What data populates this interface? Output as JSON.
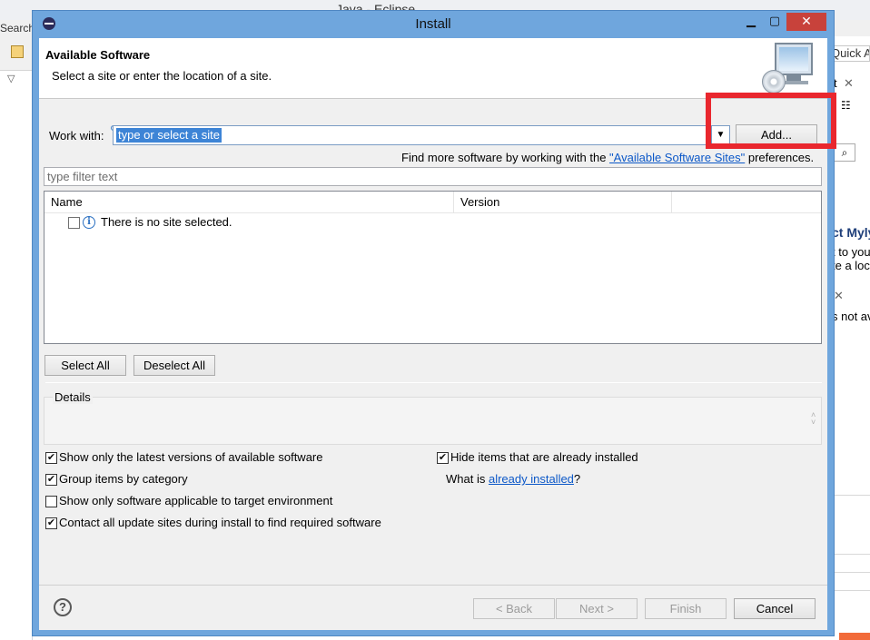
{
  "background": {
    "title": "Java - Eclipse",
    "search": "Search",
    "quick_access": "Quick Access",
    "right_fragments": [
      "t",
      "ct Myly",
      "t to you",
      "te a loc",
      "s not av"
    ]
  },
  "dialog": {
    "title": "Install",
    "header": {
      "title": "Available Software",
      "description": "Select a site or enter the location of a site."
    },
    "work_with": {
      "label": "Work with:",
      "value": "type or select a site",
      "add_button": "Add...",
      "find_more_prefix": "Find more software by working with the ",
      "find_more_link": "\"Available Software Sites\"",
      "find_more_suffix": " preferences."
    },
    "filter": {
      "placeholder": "type filter text"
    },
    "table": {
      "columns": [
        "Name",
        "Version"
      ],
      "rows": [
        {
          "label": "There is no site selected.",
          "checked": false
        }
      ]
    },
    "select_all": "Select All",
    "deselect_all": "Deselect All",
    "details": {
      "label": "Details"
    },
    "options": {
      "latest_versions": {
        "label": "Show only the latest versions of available software",
        "checked": true
      },
      "group_by_category": {
        "label": "Group items by category",
        "checked": true
      },
      "target_env": {
        "label": "Show only software applicable to target environment",
        "checked": false
      },
      "contact_sites": {
        "label": "Contact all update sites during install to find required software",
        "checked": true
      },
      "hide_installed": {
        "label": "Hide items that are already installed",
        "checked": true
      },
      "what_is_prefix": "What is ",
      "what_is_link": "already installed",
      "what_is_suffix": "?"
    },
    "buttons": {
      "back": "< Back",
      "next": "Next >",
      "finish": "Finish",
      "cancel": "Cancel"
    },
    "highlight_color": "#e9272e",
    "accent_color": "#6fa6dd"
  }
}
